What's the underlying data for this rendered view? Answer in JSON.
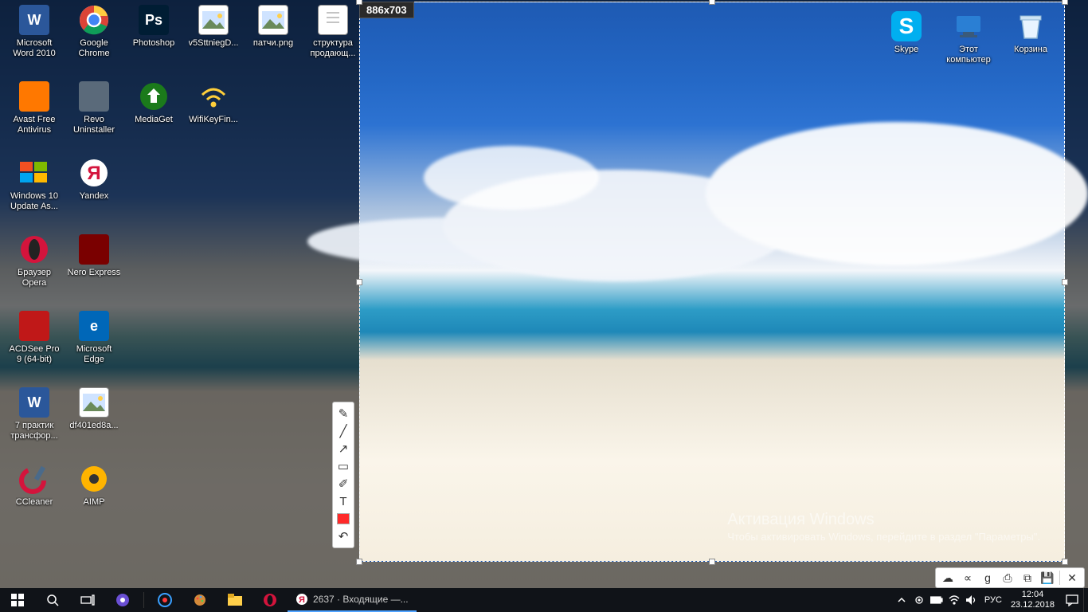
{
  "selection": {
    "dimensions": "886x703"
  },
  "desktop_icons_left": [
    {
      "label": "Microsoft Word 2010",
      "row": 0,
      "col": 0,
      "kind": "word"
    },
    {
      "label": "Google Chrome",
      "row": 0,
      "col": 1,
      "kind": "chrome"
    },
    {
      "label": "Photoshop",
      "row": 0,
      "col": 2,
      "kind": "ps"
    },
    {
      "label": "v5SttniegD...",
      "row": 0,
      "col": 3,
      "kind": "img"
    },
    {
      "label": "патчи.png",
      "row": 0,
      "col": 4,
      "kind": "img"
    },
    {
      "label": "структура продающ...",
      "row": 0,
      "col": 5,
      "kind": "doc"
    },
    {
      "label": "Avast Free Antivirus",
      "row": 1,
      "col": 0,
      "kind": "avast"
    },
    {
      "label": "Revo Uninstaller",
      "row": 1,
      "col": 1,
      "kind": "revo"
    },
    {
      "label": "MediaGet",
      "row": 1,
      "col": 2,
      "kind": "mg"
    },
    {
      "label": "WifiKeyFin...",
      "row": 1,
      "col": 3,
      "kind": "wifi"
    },
    {
      "label": "Windows 10 Update As...",
      "row": 2,
      "col": 0,
      "kind": "win10"
    },
    {
      "label": "Yandex",
      "row": 2,
      "col": 1,
      "kind": "yandex"
    },
    {
      "label": "Браузер Opera",
      "row": 3,
      "col": 0,
      "kind": "opera"
    },
    {
      "label": "Nero Express",
      "row": 3,
      "col": 1,
      "kind": "nero"
    },
    {
      "label": "ACDSee Pro 9 (64-bit)",
      "row": 4,
      "col": 0,
      "kind": "acdsee"
    },
    {
      "label": "Microsoft Edge",
      "row": 4,
      "col": 1,
      "kind": "edge"
    },
    {
      "label": "7 практик трансфор...",
      "row": 5,
      "col": 0,
      "kind": "word"
    },
    {
      "label": "df401ed8a...",
      "row": 5,
      "col": 1,
      "kind": "img"
    },
    {
      "label": "CCleaner",
      "row": 6,
      "col": 0,
      "kind": "cc"
    },
    {
      "label": "AIMP",
      "row": 6,
      "col": 1,
      "kind": "aimp"
    }
  ],
  "desktop_icons_right": [
    {
      "label": "Skype",
      "col": 0,
      "kind": "skype"
    },
    {
      "label": "Этот компьютер",
      "col": 1,
      "kind": "pc"
    },
    {
      "label": "Корзина",
      "col": 2,
      "kind": "bin"
    }
  ],
  "snip_tools": [
    {
      "name": "pencil-tool-icon",
      "glyph": "✎"
    },
    {
      "name": "line-tool-icon",
      "glyph": "╱"
    },
    {
      "name": "arrow-tool-icon",
      "glyph": "↗"
    },
    {
      "name": "rect-tool-icon",
      "glyph": "▭"
    },
    {
      "name": "marker-tool-icon",
      "glyph": "✐"
    },
    {
      "name": "text-tool-icon",
      "glyph": "T"
    },
    {
      "name": "color-swatch",
      "glyph": ""
    },
    {
      "name": "undo-icon",
      "glyph": "↶"
    }
  ],
  "snip_actions": [
    {
      "name": "upload-cloud-icon",
      "glyph": "☁"
    },
    {
      "name": "share-icon",
      "glyph": "∝"
    },
    {
      "name": "google-search-icon",
      "glyph": "g"
    },
    {
      "name": "print-icon",
      "glyph": "⎙"
    },
    {
      "name": "copy-icon",
      "glyph": "⧉"
    },
    {
      "name": "save-icon",
      "glyph": "💾"
    },
    {
      "name": "close-icon",
      "glyph": "✕"
    }
  ],
  "activation": {
    "title": "Активация Windows",
    "line": "Чтобы активировать Windows, перейдите в раздел \"Параметры\"."
  },
  "taskbar": {
    "browser_title": "2637 · Входящие —...",
    "time": "12:04",
    "date": "23.12.2018"
  }
}
